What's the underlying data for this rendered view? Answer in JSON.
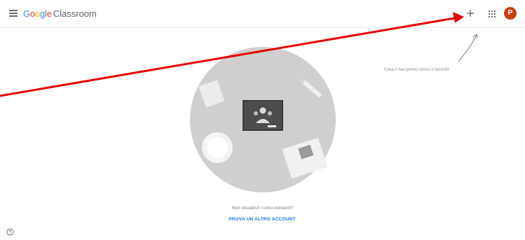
{
  "header": {
    "brand_google": "Google",
    "brand_product": "Classroom",
    "avatar_initial": "P",
    "icons": [
      "menu-icon",
      "plus-icon",
      "apps-grid-icon",
      "avatar"
    ]
  },
  "hint": {
    "text": "Crea il tuo primo corso o iscriviti"
  },
  "empty_state": {
    "question": "Non visualizzi i corsi esistenti?",
    "link_label": "PROVA UN ALTRO ACCOUNT"
  },
  "annotation": {
    "arrow_color": "#e60000"
  },
  "colors": {
    "google_blue": "#4285f4",
    "google_red": "#ea4335",
    "google_yellow": "#fbbc05",
    "google_green": "#34a853",
    "link": "#1a73e8",
    "avatar": "#c2410c"
  }
}
